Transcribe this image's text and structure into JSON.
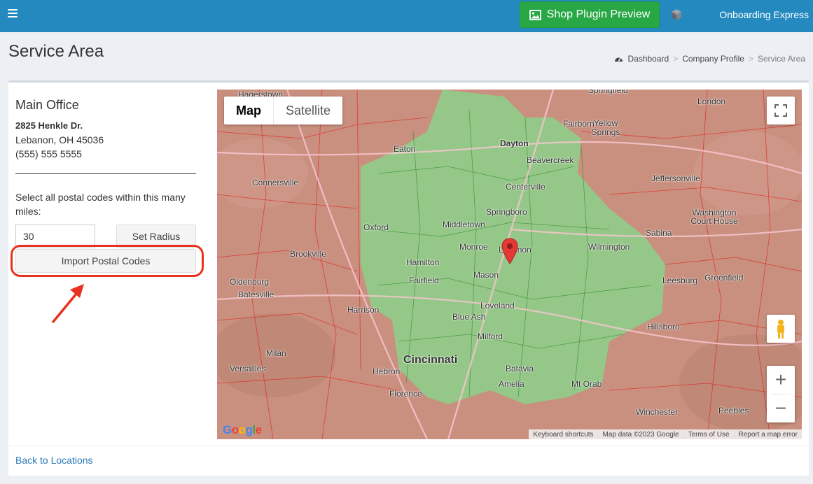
{
  "topbar": {
    "menu_icon": "hamburger-icon",
    "shop_button_label": "Shop Plugin Preview",
    "shop_button_icon": "image-icon",
    "brand_icon": "cube-icon",
    "brand_name": "Onboarding Express",
    "background_color": "#2389be",
    "shop_button_color": "#28a745"
  },
  "header": {
    "title": "Service Area",
    "breadcrumb": [
      "Dashboard",
      "Company Profile",
      "Service Area"
    ],
    "breadcrumb_icon": "dashboard-icon"
  },
  "office": {
    "title": "Main Office",
    "address_line1": "2825 Henkle Dr.",
    "address_line2": "Lebanon, OH 45036",
    "phone": "(555) 555 5555"
  },
  "radius": {
    "label": "Select all postal codes within this many miles:",
    "value": "30",
    "set_button": "Set Radius",
    "import_button": "Import Postal Codes"
  },
  "map": {
    "type_options": [
      "Map",
      "Satellite"
    ],
    "selected_type": "Map",
    "labels": [
      "Hagerstown",
      "Springfield",
      "London",
      "Fairborn",
      "Yellow Springs",
      "Dayton",
      "Eaton",
      "Beavercreek",
      "Centerville",
      "Jeffersonville",
      "Connersville",
      "Springboro",
      "Washington Court House",
      "Oxford",
      "Middletown",
      "Sabina",
      "Monroe",
      "Lebanon",
      "Wilmington",
      "Brookville",
      "Hamilton",
      "Mason",
      "Oldenburg",
      "Fairfield",
      "Leesburg",
      "Greenfield",
      "Batesville",
      "Harrison",
      "Loveland",
      "Blue Ash",
      "Hillsboro",
      "Milford",
      "Milan",
      "Cincinnati",
      "Batavia",
      "Versailles",
      "Hebron",
      "Amelia",
      "Mt Orab",
      "Florence",
      "Winchester",
      "Peebles"
    ],
    "highlight_color": "#8fce8a",
    "outside_color": "#c98f80",
    "attribution": [
      "Keyboard shortcuts",
      "Map data ©2023 Google",
      "Terms of Use",
      "Report a map error"
    ],
    "logo_text": "Google"
  },
  "footer": {
    "back_link": "Back to Locations"
  }
}
